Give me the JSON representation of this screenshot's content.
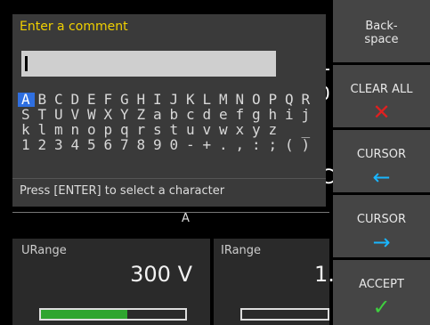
{
  "background": {
    "unit_a": "A",
    "urange_label": "URange",
    "urange_value": "300 V",
    "irange_label": "IRange",
    "irange_value": "1.",
    "urange_bar_fill_fraction": 0.6,
    "partial_glyphs": [
      "0",
      "C",
      ": l"
    ]
  },
  "dialog": {
    "title": "Enter a comment",
    "input_value": "",
    "char_rows": [
      [
        "A",
        "B",
        "C",
        "D",
        "E",
        "F",
        "G",
        "H",
        "I",
        "J",
        "K",
        "L",
        "M",
        "N",
        "O",
        "P",
        "Q",
        "R"
      ],
      [
        "S",
        "T",
        "U",
        "V",
        "W",
        "X",
        "Y",
        "Z",
        "a",
        "b",
        "c",
        "d",
        "e",
        "f",
        "g",
        "h",
        "i",
        "j"
      ],
      [
        "k",
        "l",
        "m",
        "n",
        "o",
        "p",
        "q",
        "r",
        "s",
        "t",
        "u",
        "v",
        "w",
        "x",
        "y",
        "z",
        " ",
        "_"
      ],
      [
        "1",
        "2",
        "3",
        "4",
        "5",
        "6",
        "7",
        "8",
        "9",
        "0",
        "-",
        "+",
        ".",
        ",",
        ":",
        ";",
        "(",
        ")"
      ]
    ],
    "selected_char": "A",
    "hint": "Press [ENTER] to select a character"
  },
  "softkeys": [
    {
      "label": "Back-\nspace",
      "icon": "",
      "icon_name": "",
      "color": "#ffffff"
    },
    {
      "label": "CLEAR ALL",
      "icon": "✕",
      "icon_name": "clear-x-icon",
      "color": "#e02020"
    },
    {
      "label": "CURSOR",
      "icon": "←",
      "icon_name": "arrow-left-icon",
      "color": "#19b6ff"
    },
    {
      "label": "CURSOR",
      "icon": "→",
      "icon_name": "arrow-right-icon",
      "color": "#19b6ff"
    },
    {
      "label": "ACCEPT",
      "icon": "✓",
      "icon_name": "check-icon",
      "color": "#3fcf3f"
    }
  ],
  "colors": {
    "title_yellow": "#f0d000",
    "selection_blue": "#2f6fe0",
    "bar_green": "#2fa52f"
  }
}
